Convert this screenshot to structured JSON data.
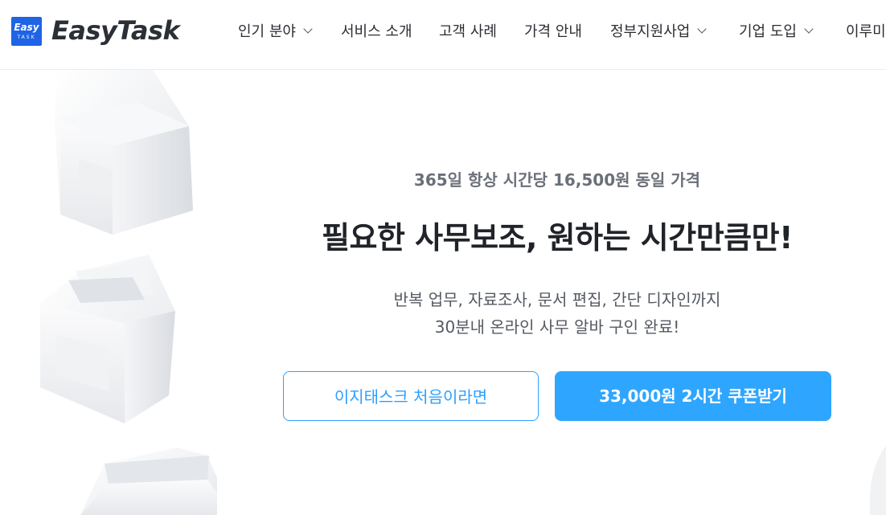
{
  "header": {
    "logo_badge_line1": "Easy",
    "logo_badge_line2": "TASK",
    "logo_text": "EasyTask",
    "nav": [
      {
        "label": "인기 분야"
      },
      {
        "label": "서비스 소개"
      },
      {
        "label": "고객 사례"
      },
      {
        "label": "가격 안내"
      },
      {
        "label": "정부지원사업"
      },
      {
        "label": "기업 도입"
      },
      {
        "label": "이루미"
      }
    ]
  },
  "hero": {
    "subtitle": "365일 항상 시간당 16,500원 동일 가격",
    "title": "필요한 사무보조, 원하는 시간만큼만!",
    "desc_line1": "반복 업무, 자료조사, 문서 편집, 간단 디자인까지",
    "desc_line2": "30분내 온라인 사무 알바 구인 완료!",
    "btn_first": "이지태스크 처음이라면",
    "btn_coupon": "33,000원 2시간 쿠폰받기"
  },
  "colors": {
    "brand_blue": "#1f63e6",
    "accent": "#2ea6ff"
  }
}
